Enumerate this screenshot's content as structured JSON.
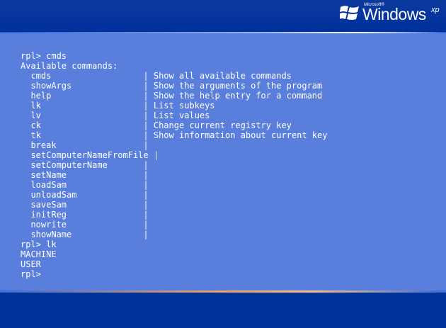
{
  "logo": {
    "microsoft": "Microsoft®",
    "windows": "Windows",
    "xp": "xp"
  },
  "terminal": {
    "lines": [
      "rpl> cmds",
      "Available commands:",
      "  cmds                  | Show all available commands",
      "  showArgs              | Show the arguments of the program",
      "  help                  | Show the help entry for a command",
      "  lk                    | List subkeys",
      "  lv                    | List values",
      "  ck                    | Change current registry key",
      "  tk                    | Show information about current key",
      "  break                 |",
      "  setComputerNameFromFile |",
      "  setComputerName       |",
      "  setName               |",
      "  loadSam               |",
      "  unloadSam             |",
      "  saveSam               |",
      "  initReg               |",
      "  nowrite               |",
      "  showName              |",
      "rpl> lk",
      "MACHINE",
      "USER",
      "rpl>"
    ]
  },
  "colors": {
    "background_main": "#5a7edc",
    "background_bars": "#003399",
    "text": "#ffffff"
  },
  "icons": {
    "logo": "windows-flag-icon"
  }
}
